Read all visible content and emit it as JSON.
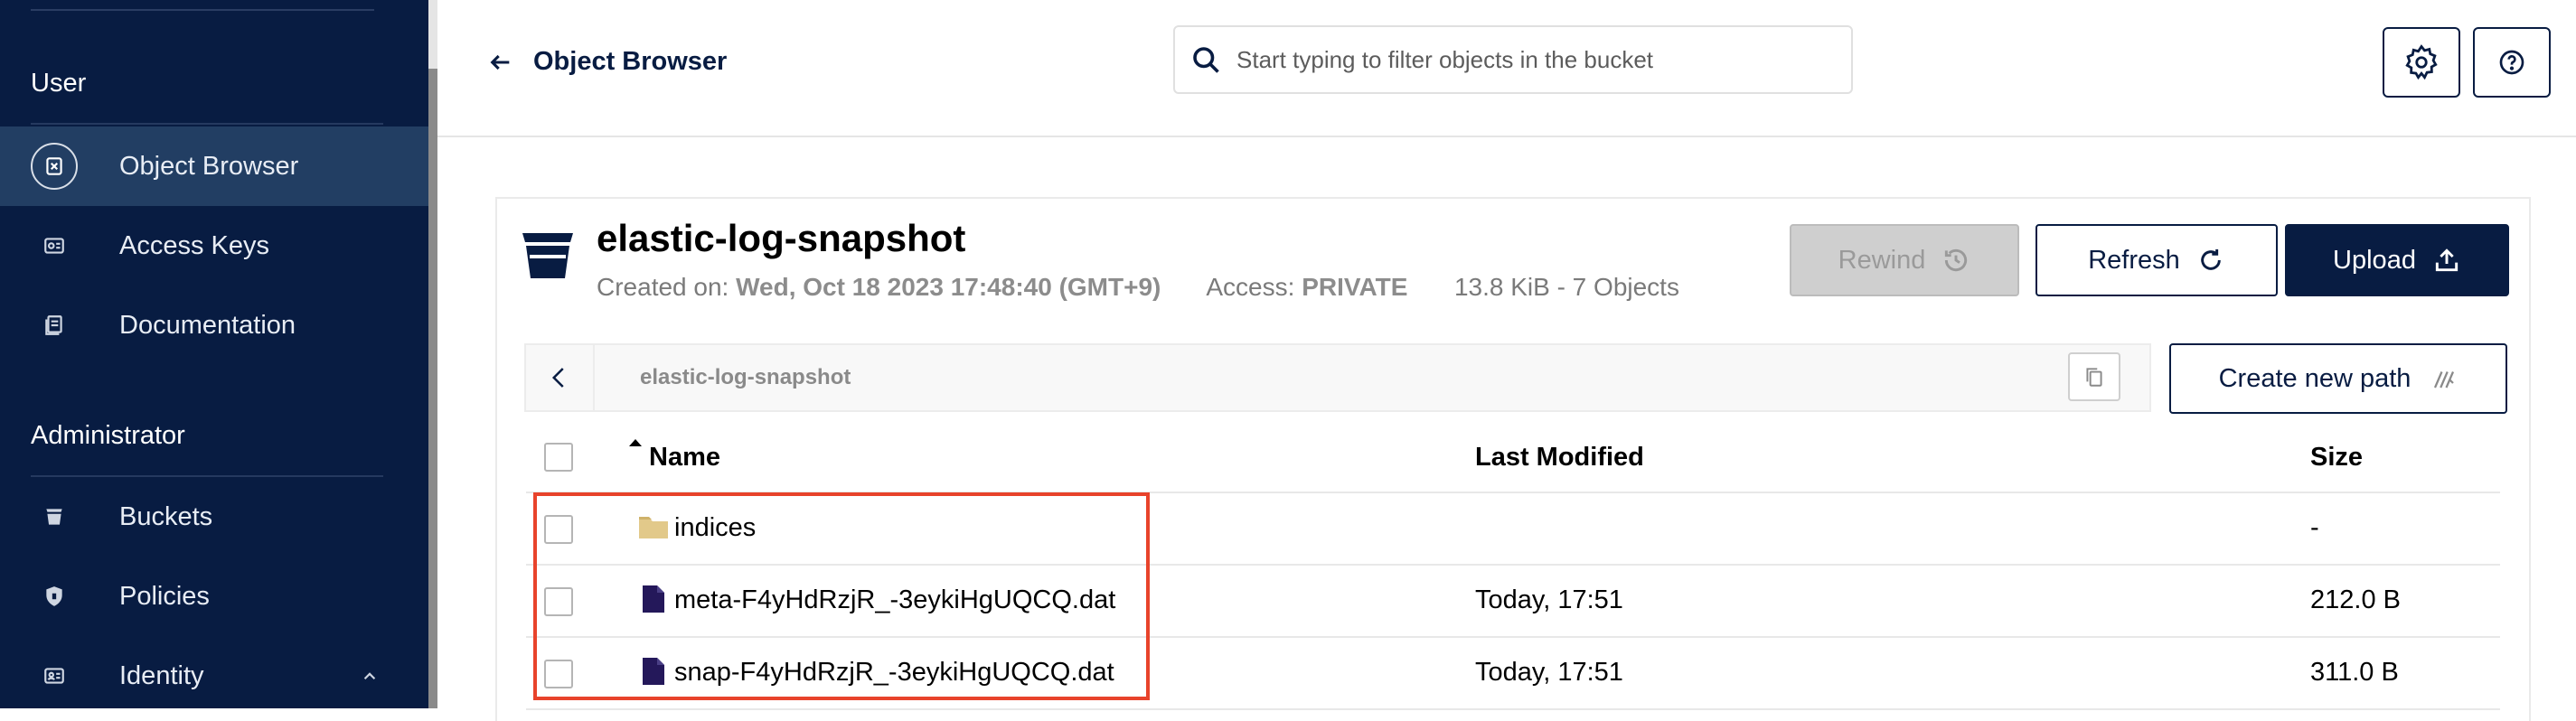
{
  "sidebar": {
    "sections": [
      {
        "title": "User"
      },
      {
        "title": "Administrator"
      }
    ],
    "items": [
      {
        "label": "Object Browser",
        "icon": "object-browser-icon",
        "active": true
      },
      {
        "label": "Access Keys",
        "icon": "access-keys-icon"
      },
      {
        "label": "Documentation",
        "icon": "documentation-icon"
      },
      {
        "label": "Buckets",
        "icon": "buckets-icon"
      },
      {
        "label": "Policies",
        "icon": "policies-icon"
      },
      {
        "label": "Identity",
        "icon": "identity-icon",
        "expandable": true
      }
    ]
  },
  "header": {
    "back_label": "Object Browser",
    "search_placeholder": "Start typing to filter objects in the bucket",
    "settings_icon": "gear-icon",
    "help_icon": "question-icon"
  },
  "bucket": {
    "name": "elastic-log-snapshot",
    "created_label": "Created on:",
    "created_value": "Wed, Oct 18 2023 17:48:40 (GMT+9)",
    "access_label": "Access:",
    "access_value": "PRIVATE",
    "size_summary": "13.8 KiB - 7 Objects",
    "rewind_label": "Rewind",
    "refresh_label": "Refresh",
    "upload_label": "Upload"
  },
  "path": {
    "current": "elastic-log-snapshot",
    "create_label": "Create new path"
  },
  "table": {
    "columns": {
      "name": "Name",
      "modified": "Last Modified",
      "size": "Size"
    },
    "sort": {
      "column": "name",
      "direction": "ascending"
    },
    "rows": [
      {
        "type": "folder",
        "name": "indices",
        "modified": "",
        "size": "-"
      },
      {
        "type": "file",
        "name": "meta-F4yHdRzjR_-3eykiHgUQCQ.dat",
        "modified": "Today, 17:51",
        "size": "212.0 B"
      },
      {
        "type": "file",
        "name": "snap-F4yHdRzjR_-3eykiHgUQCQ.dat",
        "modified": "Today, 17:51",
        "size": "311.0 B"
      }
    ]
  },
  "colors": {
    "navy": "#081c42",
    "sidebar_active": "#223e63",
    "highlight": "#e8432b",
    "folder": "#e2c98a",
    "file": "#24185a"
  }
}
